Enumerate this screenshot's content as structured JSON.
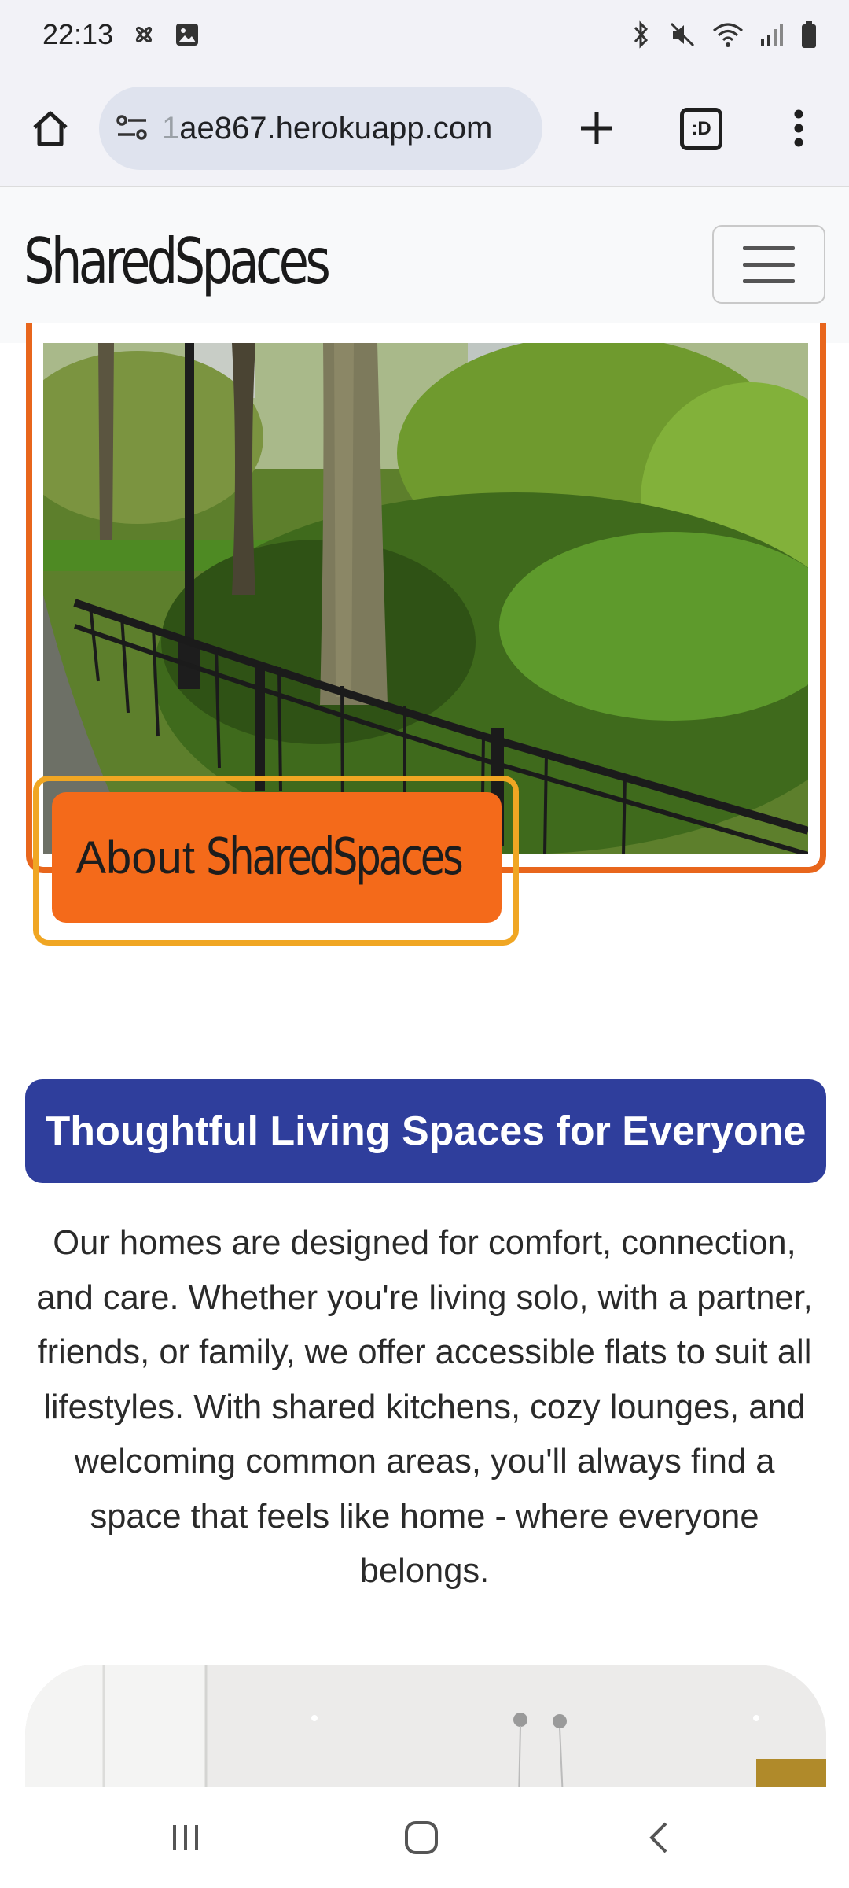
{
  "status_bar": {
    "time": "22:13",
    "left_icons": [
      "fan-icon",
      "image-icon"
    ],
    "right_icons": [
      "bluetooth-icon",
      "mute-icon",
      "wifi-icon",
      "signal-icon",
      "battery-icon"
    ]
  },
  "browser": {
    "url_prefix": "1",
    "url": "ae867.herokuapp.com",
    "tab_count": ":D"
  },
  "site": {
    "brand": "SharedSpaces"
  },
  "hero": {
    "about_prefix": "About",
    "about_brand": "SharedSpaces"
  },
  "content": {
    "heading": "Thoughtful Living Spaces for Everyone",
    "paragraph": "Our homes are designed for comfort, connection, and care. Whether you're living solo, with a partner, friends, or family, we offer accessible flats to suit all lifestyles. With shared kitchens, cozy lounges, and welcoming common areas, you'll always find a space that feels like home - where everyone belongs."
  },
  "colors": {
    "accent_orange": "#f46a1a",
    "frame_orange": "#e8661c",
    "highlight_yellow": "#f0a623",
    "banner_blue": "#2f3e9c"
  }
}
